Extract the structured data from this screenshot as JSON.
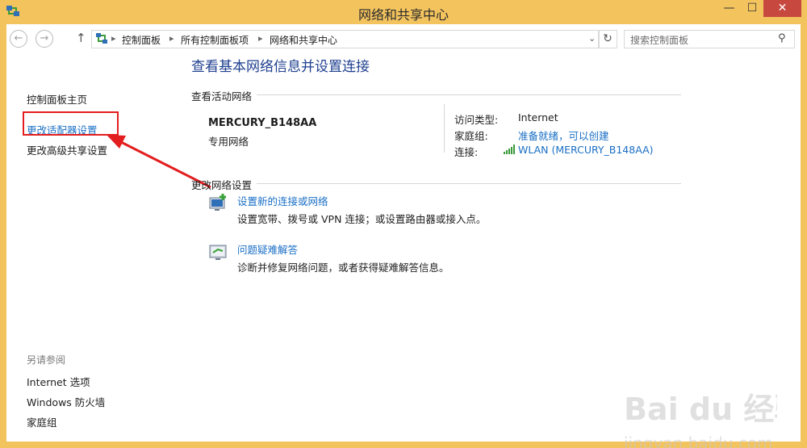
{
  "window": {
    "title": "网络和共享中心",
    "minimize_glyph": "—",
    "maximize_glyph": "☐",
    "close_glyph": "✕"
  },
  "nav": {
    "back_glyph": "←",
    "forward_glyph": "→",
    "up_glyph": "↑",
    "breadcrumb": [
      "控制面板",
      "所有控制面板项",
      "网络和共享中心"
    ],
    "separator_glyph": "▸",
    "dropdown_glyph": "⌄",
    "refresh_glyph": "↻"
  },
  "search": {
    "placeholder": "搜索控制面板",
    "icon_glyph": "⚲"
  },
  "sidebar": {
    "items": [
      {
        "label": "控制面板主页"
      },
      {
        "label": "更改适配器设置"
      },
      {
        "label": "更改高级共享设置"
      }
    ],
    "see_also_heading": "另请参阅",
    "see_also": [
      {
        "label": "Internet 选项"
      },
      {
        "label": "Windows 防火墙"
      },
      {
        "label": "家庭组"
      }
    ]
  },
  "main": {
    "title": "查看基本网络信息并设置连接",
    "active_heading": "查看活动网络",
    "network": {
      "name": "MERCURY_B148AA",
      "type": "专用网络",
      "access_label": "访问类型:",
      "access_value": "Internet",
      "homegroup_label": "家庭组:",
      "homegroup_value": "准备就绪，可以创建",
      "connection_label": "连接:",
      "connection_value": "WLAN (MERCURY_B148AA)"
    },
    "change_heading": "更改网络设置",
    "tasks": [
      {
        "title": "设置新的连接或网络",
        "desc": "设置宽带、拨号或 VPN 连接；或设置路由器或接入点。",
        "icon": "network-setup-icon"
      },
      {
        "title": "问题疑难解答",
        "desc": "诊断并修复网络问题，或者获得疑难解答信息。",
        "icon": "troubleshoot-icon"
      }
    ]
  },
  "colors": {
    "frame": "#f3c35e",
    "link": "#1a6fc5",
    "title": "#1e3f8f",
    "highlight": "#e31e1e",
    "close": "#c7483f"
  },
  "watermark": {
    "brand": "Bai du 经验",
    "url": "jingyan.baidu.com"
  }
}
